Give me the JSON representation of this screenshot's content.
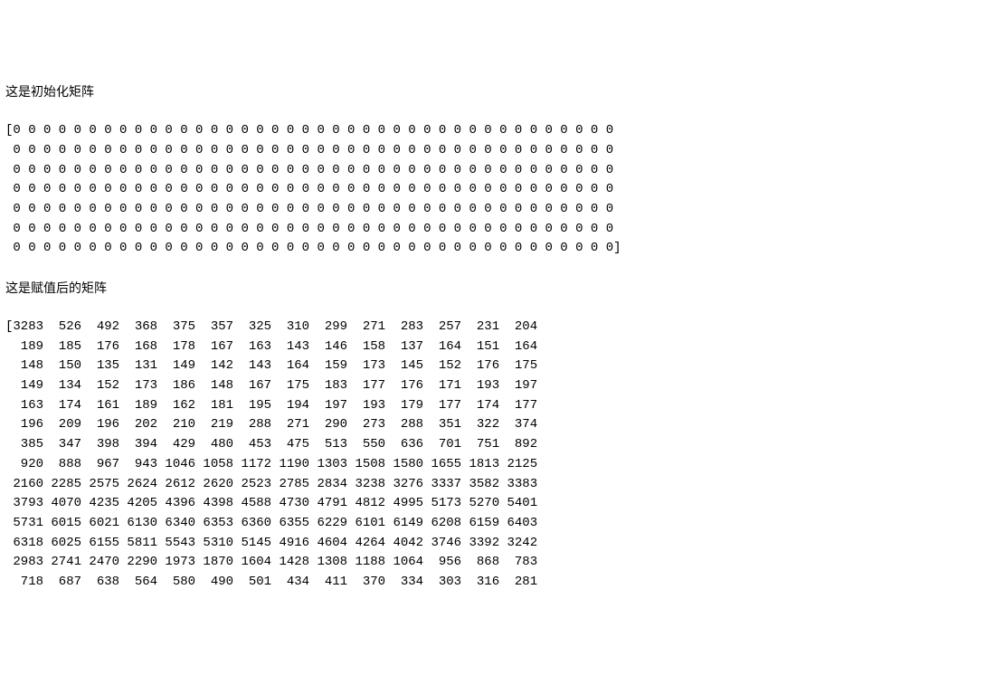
{
  "label_init": "这是初始化矩阵",
  "label_assigned": "这是赋值后的矩阵",
  "init_matrix_cols": 40,
  "init_matrix_rows": 7,
  "init_value": 0,
  "assigned_cols": 14,
  "assigned_col_width": 5,
  "assigned_matrix": [
    [
      3283,
      526,
      492,
      368,
      375,
      357,
      325,
      310,
      299,
      271,
      283,
      257,
      231,
      204
    ],
    [
      189,
      185,
      176,
      168,
      178,
      167,
      163,
      143,
      146,
      158,
      137,
      164,
      151,
      164
    ],
    [
      148,
      150,
      135,
      131,
      149,
      142,
      143,
      164,
      159,
      173,
      145,
      152,
      176,
      175
    ],
    [
      149,
      134,
      152,
      173,
      186,
      148,
      167,
      175,
      183,
      177,
      176,
      171,
      193,
      197
    ],
    [
      163,
      174,
      161,
      189,
      162,
      181,
      195,
      194,
      197,
      193,
      179,
      177,
      174,
      177
    ],
    [
      196,
      209,
      196,
      202,
      210,
      219,
      288,
      271,
      290,
      273,
      288,
      351,
      322,
      374
    ],
    [
      385,
      347,
      398,
      394,
      429,
      480,
      453,
      475,
      513,
      550,
      636,
      701,
      751,
      892
    ],
    [
      920,
      888,
      967,
      943,
      1046,
      1058,
      1172,
      1190,
      1303,
      1508,
      1580,
      1655,
      1813,
      2125
    ],
    [
      2160,
      2285,
      2575,
      2624,
      2612,
      2620,
      2523,
      2785,
      2834,
      3238,
      3276,
      3337,
      3582,
      3383
    ],
    [
      3793,
      4070,
      4235,
      4205,
      4396,
      4398,
      4588,
      4730,
      4791,
      4812,
      4995,
      5173,
      5270,
      5401
    ],
    [
      5731,
      6015,
      6021,
      6130,
      6340,
      6353,
      6360,
      6355,
      6229,
      6101,
      6149,
      6208,
      6159,
      6403
    ],
    [
      6318,
      6025,
      6155,
      5811,
      5543,
      5310,
      5145,
      4916,
      4604,
      4264,
      4042,
      3746,
      3392,
      3242
    ],
    [
      2983,
      2741,
      2470,
      2290,
      1973,
      1870,
      1604,
      1428,
      1308,
      1188,
      1064,
      956,
      868,
      783
    ],
    [
      718,
      687,
      638,
      564,
      580,
      490,
      501,
      434,
      411,
      370,
      334,
      303,
      316,
      281
    ]
  ]
}
